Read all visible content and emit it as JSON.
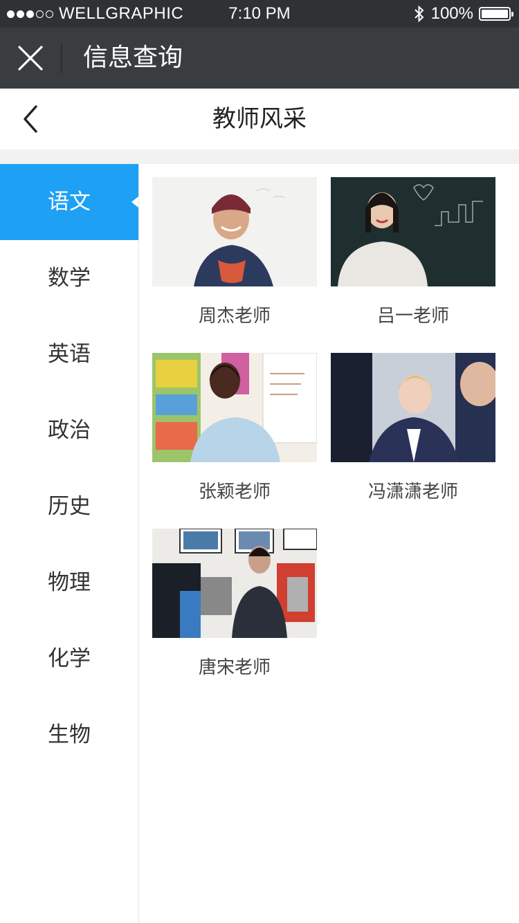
{
  "status_bar": {
    "carrier": "WELLGRAPHIC",
    "time": "7:10 PM",
    "battery": "100%",
    "signal_bars": 3,
    "signal_total": 5
  },
  "nav": {
    "title": "信息查询",
    "close_icon": "close-icon"
  },
  "header": {
    "title": "教师风采",
    "back_icon": "chevron-left-icon"
  },
  "sidebar": {
    "items": [
      {
        "label": "语文",
        "active": true
      },
      {
        "label": "数学",
        "active": false
      },
      {
        "label": "英语",
        "active": false
      },
      {
        "label": "政治",
        "active": false
      },
      {
        "label": "历史",
        "active": false
      },
      {
        "label": "物理",
        "active": false
      },
      {
        "label": "化学",
        "active": false
      },
      {
        "label": "生物",
        "active": false
      }
    ]
  },
  "teachers": [
    {
      "name": "周杰老师"
    },
    {
      "name": "吕一老师"
    },
    {
      "name": "张颖老师"
    },
    {
      "name": "冯潇潇老师"
    },
    {
      "name": "唐宋老师"
    }
  ],
  "colors": {
    "accent": "#1ea0f5",
    "status_bar": "#2e3235",
    "nav_bar": "#393d40"
  }
}
